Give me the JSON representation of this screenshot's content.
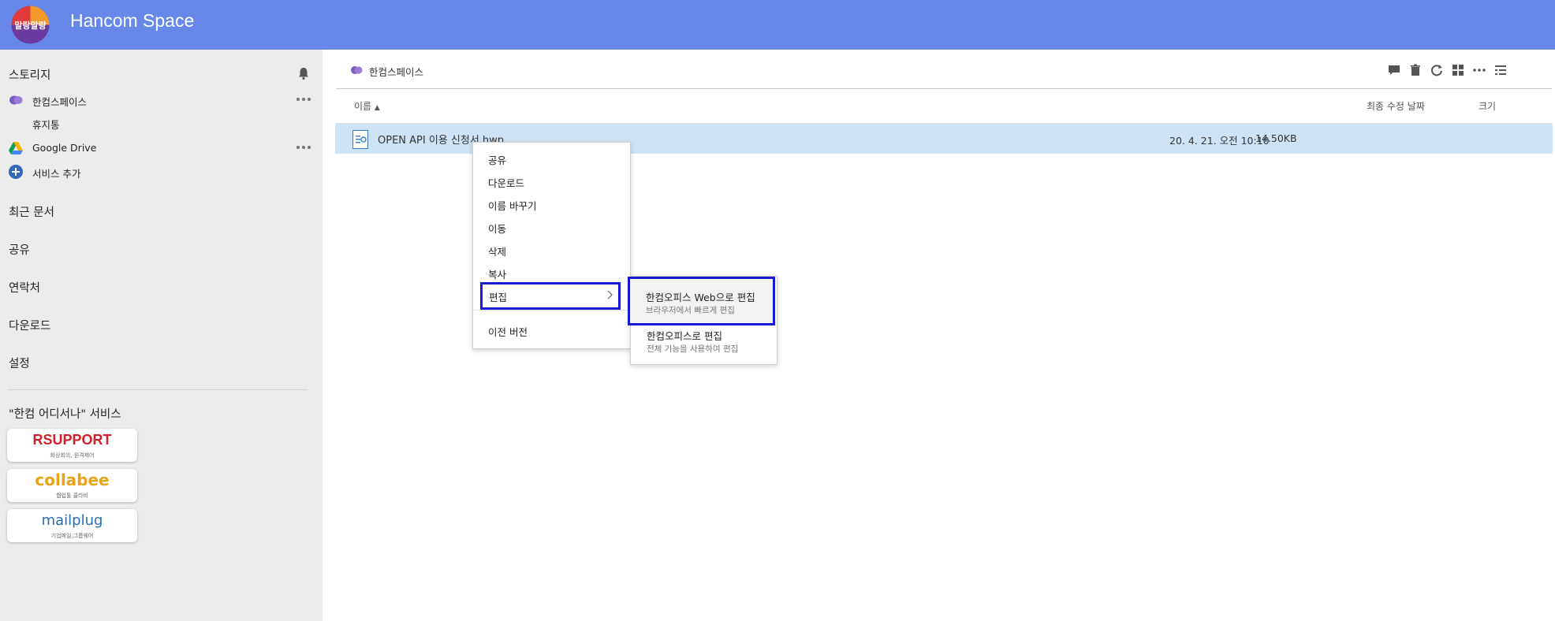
{
  "header": {
    "title": "Hancom Space",
    "logo_text": "말랑말랑"
  },
  "sidebar": {
    "storage_title": "스토리지",
    "items": [
      {
        "label": "한컴스페이스"
      },
      {
        "label": "휴지통"
      },
      {
        "label": "Google Drive"
      },
      {
        "label": "서비스 추가"
      }
    ],
    "nav": [
      "최근 문서",
      "공유",
      "연락처",
      "다운로드",
      "설정"
    ],
    "services_title": "\"한컴 어디서나\" 서비스",
    "partners": [
      {
        "brand": "RSUPPORT",
        "tag": "화상회의, 원격제어",
        "color": "#d11f2a"
      },
      {
        "brand": "collabee",
        "tag": "협업툴 콜라비",
        "color": "#e8a317"
      },
      {
        "brand": "mailplug",
        "tag": "기업메일,그룹웨어",
        "color": "#2a7fd4"
      }
    ]
  },
  "main": {
    "breadcrumb": "한컴스페이스",
    "toolbar": [
      "comment-icon",
      "trash-icon",
      "refresh-icon",
      "grid-view-icon",
      "more-icon",
      "list-view-icon"
    ],
    "columns": {
      "name": "이름",
      "modified": "최종 수정 날짜",
      "size": "크기"
    },
    "file": {
      "name": "OPEN API 이용 신청서.hwp",
      "modified": "20. 4. 21. 오전 10:10",
      "size": "14.50KB"
    }
  },
  "context_menu": {
    "items": [
      "공유",
      "다운로드",
      "이름 바꾸기",
      "이동",
      "삭제",
      "복사"
    ],
    "edit": "편집",
    "prev_version": "이전 버전"
  },
  "submenu": {
    "web_title": "한컴오피스 Web으로 편집",
    "web_desc": "브라우저에서 빠르게 편집",
    "app_title": "한컴오피스로 편집",
    "app_desc": "전체 기능을 사용하여 편집"
  },
  "colors": {
    "header": "#6788e8",
    "sidebar": "#ececec",
    "selection": "#cfe3f6",
    "highlight_border": "#1a1ad6"
  }
}
